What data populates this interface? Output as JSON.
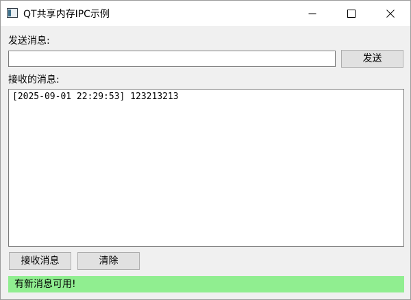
{
  "window": {
    "title": "QT共享内存IPC示例"
  },
  "icons": {
    "app": "app-window-icon",
    "minimize": "minimize-icon",
    "maximize": "maximize-icon",
    "close": "close-icon"
  },
  "send": {
    "label": "发送消息:",
    "input_value": "",
    "button_label": "发送"
  },
  "receive": {
    "label": "接收的消息:",
    "messages": "[2025-09-01 22:29:53] 123213213"
  },
  "actions": {
    "receive_button_label": "接收消息",
    "clear_button_label": "清除"
  },
  "status": {
    "text": "有新消息可用!",
    "background_color": "#90ee90"
  }
}
